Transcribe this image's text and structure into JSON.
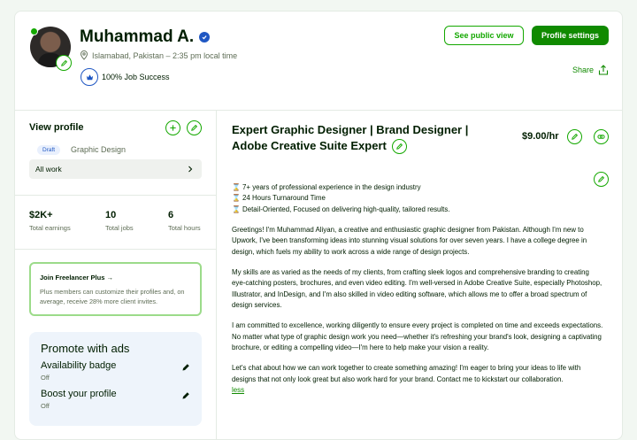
{
  "header": {
    "name": "Muhammad A.",
    "location": "Islamabad, Pakistan – 2:35 pm local time",
    "job_success": "100% Job Success",
    "see_public_view": "See public view",
    "profile_settings": "Profile settings",
    "share": "Share"
  },
  "sidebar": {
    "view_profile": "View profile",
    "draft_badge": "Draft",
    "specialization": "Graphic Design",
    "all_work": "All work",
    "stats": [
      {
        "value": "$2K+",
        "label": "Total earnings"
      },
      {
        "value": "10",
        "label": "Total jobs"
      },
      {
        "value": "6",
        "label": "Total hours"
      }
    ],
    "freelancer_plus": {
      "title": "Join Freelancer Plus →",
      "description": "Plus members can customize their profiles and, on average, receive 28% more client invites."
    },
    "promote": {
      "title": "Promote with ads",
      "availability_label": "Availability badge",
      "availability_status": "Off",
      "boost_label": "Boost your profile",
      "boost_status": "Off"
    }
  },
  "main": {
    "title": "Expert Graphic Designer | Brand Designer | Adobe Creative Suite Expert",
    "rate": "$9.00/hr",
    "bullets": [
      "⌛ 7+ years of professional experience in the design industry",
      "⌛ 24 Hours Turnaround Time",
      "⌛ Detail-Oriented, Focused on delivering high-quality, tailored results."
    ],
    "paragraphs": [
      "Greetings! I'm Muhammad Aliyan, a creative and enthusiastic graphic designer from Pakistan. Although I'm new to Upwork, I've been transforming ideas into stunning visual solutions for over seven years. I have a college degree in design, which fuels my ability to work across a wide range of design projects.",
      "My skills are as varied as the needs of my clients, from crafting sleek logos and comprehensive branding to creating eye-catching posters, brochures, and even video editing. I'm well-versed in Adobe Creative Suite, especially Photoshop, Illustrator, and InDesign, and I'm also skilled in video editing software, which allows me to offer a broad spectrum of design services.",
      "I am committed to excellence, working diligently to ensure every project is completed on time and exceeds expectations. No matter what type of graphic design work you need—whether it's refreshing your brand's look, designing a captivating brochure, or editing a compelling video—I'm here to help make your vision a reality.",
      "Let's chat about how we can work together to create something amazing! I'm eager to bring your ideas to life with designs that not only look great but also work hard for your brand. Contact me to kickstart our collaboration."
    ],
    "less_link": "less"
  },
  "colors": {
    "brand_green": "#14a800",
    "dark_green": "#108a00",
    "verified_blue": "#1f57c3"
  }
}
